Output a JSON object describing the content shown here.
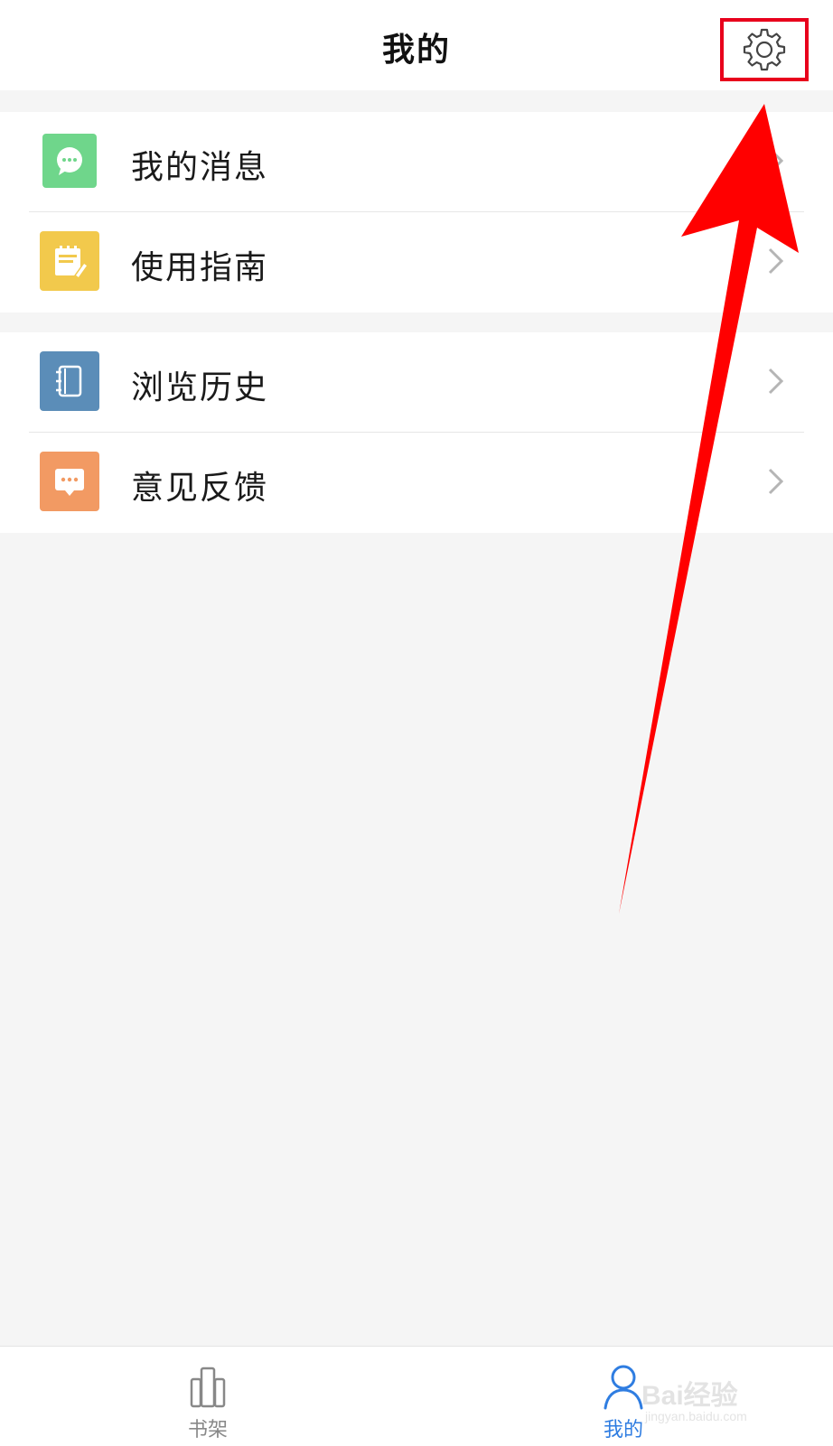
{
  "header": {
    "title": "我的"
  },
  "menu": {
    "group1": [
      {
        "label": "我的消息",
        "icon": "message-icon",
        "color": "#6fd68b"
      },
      {
        "label": "使用指南",
        "icon": "guide-icon",
        "color": "#f2c94c"
      }
    ],
    "group2": [
      {
        "label": "浏览历史",
        "icon": "history-icon",
        "color": "#5b8db8"
      },
      {
        "label": "意见反馈",
        "icon": "feedback-icon",
        "color": "#f29a63"
      }
    ]
  },
  "tabbar": {
    "shelf_label": "书架",
    "mine_label": "我的",
    "active_tab": "mine",
    "active_color": "#2f7de1"
  },
  "watermark": {
    "text": "Bai经验",
    "sub": "jingyan.baidu.com"
  },
  "colors": {
    "highlight": "#e8001c",
    "arrow": "#ff0000"
  }
}
